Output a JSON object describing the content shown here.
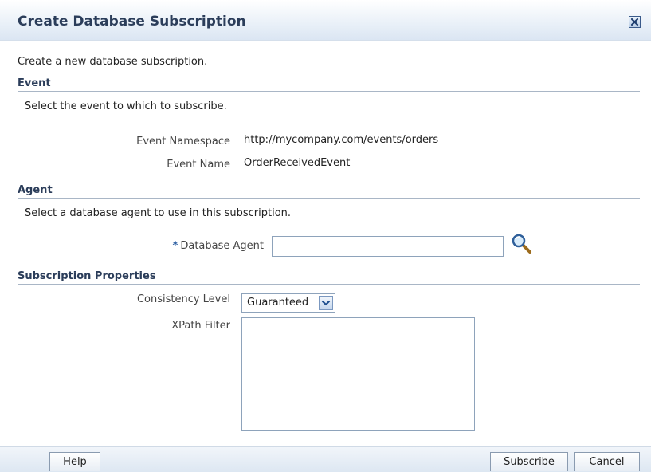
{
  "dialog": {
    "title": "Create Database Subscription",
    "intro": "Create a new database subscription."
  },
  "event": {
    "heading": "Event",
    "help": "Select the event to which to subscribe.",
    "namespace_label": "Event Namespace",
    "namespace_value": "http://mycompany.com/events/orders",
    "name_label": "Event Name",
    "name_value": "OrderReceivedEvent"
  },
  "agent": {
    "heading": "Agent",
    "help": "Select a database agent to use in this subscription.",
    "required_marker": "*",
    "db_agent_label": "Database Agent",
    "db_agent_value": ""
  },
  "properties": {
    "heading": "Subscription Properties",
    "consistency_label": "Consistency Level",
    "consistency_value": "Guaranteed",
    "xpath_label": "XPath Filter",
    "xpath_value": ""
  },
  "footer": {
    "help_label": "Help",
    "subscribe_label": "Subscribe",
    "cancel_label": "Cancel"
  },
  "icons": {
    "close": "close-icon",
    "search": "search-icon",
    "dropdown": "chevron-down-icon"
  },
  "colors": {
    "heading": "#2b3d5a",
    "title_bar": "#dbe6f3",
    "required": "#2d5fa3"
  }
}
